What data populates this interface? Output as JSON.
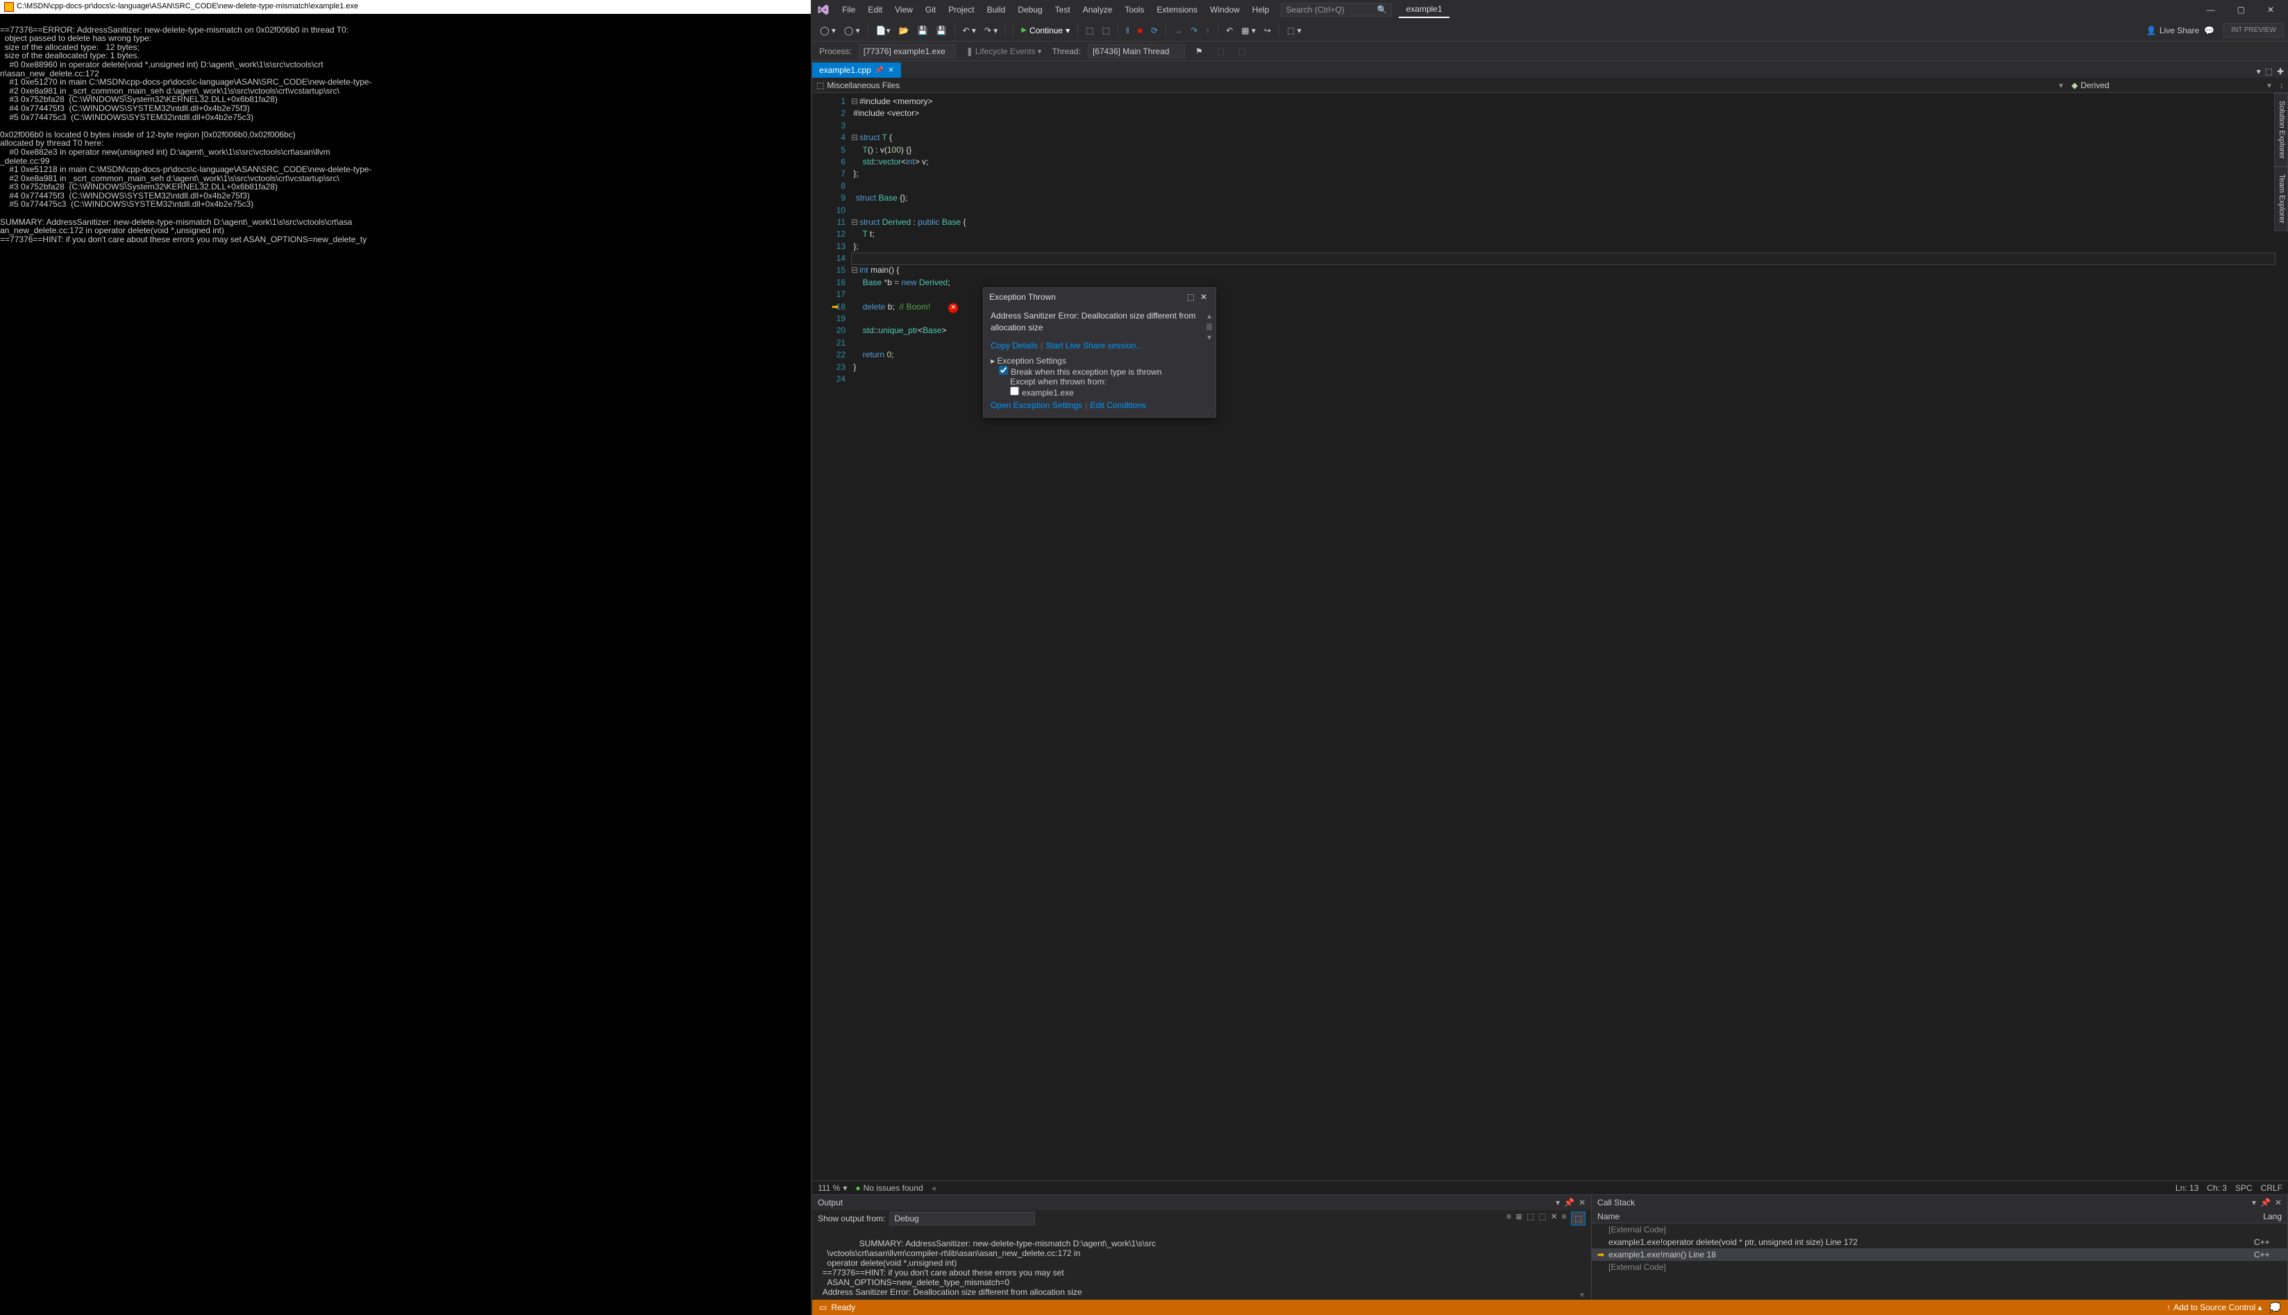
{
  "console": {
    "title": "C:\\MSDN\\cpp-docs-pr\\docs\\c-language\\ASAN\\SRC_CODE\\new-delete-type-mismatch\\example1.exe",
    "body": "\n==77376==ERROR: AddressSanitizer: new-delete-type-mismatch on 0x02f006b0 in thread T0:\n  object passed to delete has wrong type:\n  size of the allocated type:   12 bytes;\n  size of the deallocated type: 1 bytes.\n    #0 0xe88960 in operator delete(void *,unsigned int) D:\\agent\\_work\\1\\s\\src\\vctools\\crt\nn\\asan_new_delete.cc:172\n    #1 0xe51270 in main C:\\MSDN\\cpp-docs-pr\\docs\\c-language\\ASAN\\SRC_CODE\\new-delete-type-\n    #2 0xe8a981 in _scrt_common_main_seh d:\\agent\\_work\\1\\s\\src\\vctools\\crt\\vcstartup\\src\\\n    #3 0x752bfa28  (C:\\WINDOWS\\System32\\KERNEL32.DLL+0x6b81fa28)\n    #4 0x774475f3  (C:\\WINDOWS\\SYSTEM32\\ntdll.dll+0x4b2e75f3)\n    #5 0x774475c3  (C:\\WINDOWS\\SYSTEM32\\ntdll.dll+0x4b2e75c3)\n\n0x02f006b0 is located 0 bytes inside of 12-byte region [0x02f006b0,0x02f006bc)\nallocated by thread T0 here:\n    #0 0xe882e3 in operator new(unsigned int) D:\\agent\\_work\\1\\s\\src\\vctools\\crt\\asan\\llvm\n_delete.cc:99\n    #1 0xe51218 in main C:\\MSDN\\cpp-docs-pr\\docs\\c-language\\ASAN\\SRC_CODE\\new-delete-type-\n    #2 0xe8a981 in _scrt_common_main_seh d:\\agent\\_work\\1\\s\\src\\vctools\\crt\\vcstartup\\src\\\n    #3 0x752bfa28  (C:\\WINDOWS\\System32\\KERNEL32.DLL+0x6b81fa28)\n    #4 0x774475f3  (C:\\WINDOWS\\SYSTEM32\\ntdll.dll+0x4b2e75f3)\n    #5 0x774475c3  (C:\\WINDOWS\\SYSTEM32\\ntdll.dll+0x4b2e75c3)\n\nSUMMARY: AddressSanitizer: new-delete-type-mismatch D:\\agent\\_work\\1\\s\\src\\vctools\\crt\\asa\nan_new_delete.cc:172 in operator delete(void *,unsigned int)\n==77376==HINT: if you don't care about these errors you may set ASAN_OPTIONS=new_delete_ty"
  },
  "menubar": {
    "items": [
      "File",
      "Edit",
      "View",
      "Git",
      "Project",
      "Build",
      "Debug",
      "Test",
      "Analyze",
      "Tools",
      "Extensions",
      "Window",
      "Help"
    ],
    "search_placeholder": "Search (Ctrl+Q)",
    "title": "example1"
  },
  "toolbar": {
    "continue": "Continue",
    "live_share": "Live Share",
    "int_preview": "INT PREVIEW"
  },
  "debugbar": {
    "process_label": "Process:",
    "process_value": "[77376] example1.exe",
    "lifecycle": "Lifecycle Events",
    "thread_label": "Thread:",
    "thread_value": "[67436] Main Thread"
  },
  "tab": {
    "name": "example1.cpp"
  },
  "navbar": {
    "left": "Miscellaneous Files",
    "right": "Derived"
  },
  "editor": {
    "lines": [
      {
        "n": 1,
        "html": "<span class='fold'>⊟</span><span class='p'>#include </span><span class='s'>&lt;memory&gt;</span>"
      },
      {
        "n": 2,
        "html": " <span class='p'>#include </span><span class='s'>&lt;vector&gt;</span>"
      },
      {
        "n": 3,
        "html": ""
      },
      {
        "n": 4,
        "html": "<span class='fold'>⊟</span><span class='k'>struct</span> <span class='t'>T</span> {"
      },
      {
        "n": 5,
        "html": "     <span class='t'>T</span>() : v(<span class='n'>100</span>) {}"
      },
      {
        "n": 6,
        "html": "     <span class='t'>std</span>::<span class='t'>vector</span>&lt;<span class='k'>int</span>&gt; v;"
      },
      {
        "n": 7,
        "html": " };"
      },
      {
        "n": 8,
        "html": ""
      },
      {
        "n": 9,
        "html": "  <span class='k'>struct</span> <span class='t'>Base</span> {};"
      },
      {
        "n": 10,
        "html": ""
      },
      {
        "n": 11,
        "html": "<span class='fold'>⊟</span><span class='k'>struct</span> <span class='t'>Derived</span> : <span class='k'>public</span> <span class='t'>Base</span> {"
      },
      {
        "n": 12,
        "html": "     <span class='t'>T</span> t;"
      },
      {
        "n": 13,
        "html": " };",
        "current": true
      },
      {
        "n": 14,
        "html": ""
      },
      {
        "n": 15,
        "html": "<span class='fold'>⊟</span><span class='k'>int</span> main() {"
      },
      {
        "n": 16,
        "html": "     <span class='t'>Base</span> <span class='op'>*</span>b <span class='op'>=</span> <span class='k'>new</span> <span class='t'>Derived</span>;"
      },
      {
        "n": 17,
        "html": ""
      },
      {
        "n": 18,
        "html": "     <span class='k'>delete</span> b;  <span class='c'>// Boom!</span>   <span class='err-bubble'>✕</span>",
        "bp": true
      },
      {
        "n": 19,
        "html": ""
      },
      {
        "n": 20,
        "html": "     <span class='t'>std</span>::<span class='t'>unique_ptr</span>&lt;<span class='t'>Base</span>&gt;"
      },
      {
        "n": 21,
        "html": ""
      },
      {
        "n": 22,
        "html": "     <span class='k'>return</span> <span class='n'>0</span>;"
      },
      {
        "n": 23,
        "html": " }"
      },
      {
        "n": 24,
        "html": ""
      }
    ]
  },
  "sidebar_tabs": [
    "Solution Explorer",
    "Team Explorer"
  ],
  "exception": {
    "title": "Exception Thrown",
    "message": "Address Sanitizer Error: Deallocation size different from allocation size",
    "copy": "Copy Details",
    "liveshare": "Start Live Share session...",
    "settings_hdr": "Exception Settings",
    "break_label": "Break when this exception type is thrown",
    "except_label": "Except when thrown from:",
    "except_item": "example1.exe",
    "open_settings": "Open Exception Settings",
    "edit_cond": "Edit Conditions"
  },
  "statusline": {
    "zoom": "111 %",
    "issues": "No issues found",
    "ln": "Ln: 13",
    "ch": "Ch: 3",
    "spc": "SPC",
    "crlf": "CRLF"
  },
  "output": {
    "title": "Output",
    "show_label": "Show output from:",
    "show_value": "Debug",
    "body": "  SUMMARY: AddressSanitizer: new-delete-type-mismatch D:\\agent\\_work\\1\\s\\src\n    \\vctools\\crt\\asan\\llvm\\compiler-rt\\lib\\asan\\asan_new_delete.cc:172 in\n    operator delete(void *,unsigned int)\n  ==77376==HINT: if you don't care about these errors you may set\n    ASAN_OPTIONS=new_delete_type_mismatch=0\n  Address Sanitizer Error: Deallocation size different from allocation size"
  },
  "callstack": {
    "title": "Call Stack",
    "col_name": "Name",
    "col_lang": "Lang",
    "rows": [
      {
        "name": "[External Code]",
        "lang": "",
        "ext": true
      },
      {
        "name": "example1.exe!operator delete(void * ptr, unsigned int size) Line 172",
        "lang": "C++"
      },
      {
        "name": "example1.exe!main() Line 18",
        "lang": "C++",
        "current": true
      },
      {
        "name": "[External Code]",
        "lang": "",
        "ext": true
      }
    ]
  },
  "bottombar": {
    "ready": "Ready",
    "add_source": "Add to Source Control"
  }
}
